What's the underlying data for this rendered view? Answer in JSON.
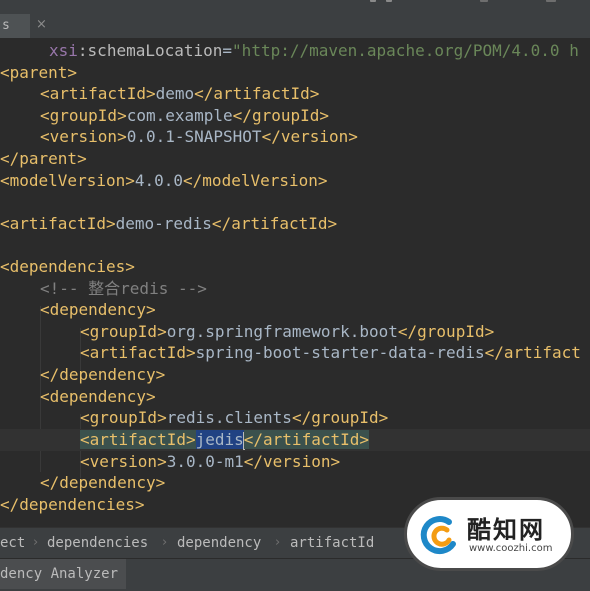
{
  "tab": {
    "label": "s",
    "close_glyph": "×"
  },
  "code": {
    "l1": {
      "attr_prefix": "xsi",
      "attr_name": "schemaLocation",
      "eq": "=",
      "value": "\"http://maven.apache.org/POM/4.0.0 h"
    },
    "l2": {
      "text": "<parent>"
    },
    "l3": {
      "open": "<artifactId>",
      "value": "demo",
      "close": "</artifactId>"
    },
    "l4": {
      "open": "<groupId>",
      "value": "com.example",
      "close": "</groupId>"
    },
    "l5": {
      "open": "<version>",
      "value": "0.0.1-SNAPSHOT",
      "close": "</version>"
    },
    "l6": {
      "text": "</parent>"
    },
    "l7": {
      "open": "<modelVersion>",
      "value": "4.0.0",
      "close": "</modelVersion>"
    },
    "l8": {
      "open": "<artifactId>",
      "value": "demo-redis",
      "close": "</artifactId>"
    },
    "l9": {
      "text": "<dependencies>"
    },
    "l10": {
      "text": "<!-- 整合redis -->"
    },
    "l11": {
      "text": "<dependency>"
    },
    "l12": {
      "open": "<groupId>",
      "value": "org.springframework.boot",
      "close": "</groupId>"
    },
    "l13": {
      "open": "<artifactId>",
      "value": "spring-boot-starter-data-redis",
      "close": "</artifact"
    },
    "l14": {
      "text": "</dependency>"
    },
    "l15": {
      "text": "<dependency>"
    },
    "l16": {
      "open": "<groupId>",
      "value": "redis.clients",
      "close": "</groupId>"
    },
    "l17": {
      "open": "<artifactId>",
      "value": "jedis",
      "close": "</artifactId>"
    },
    "l18": {
      "open": "<version>",
      "value": "3.0.0-m1",
      "close": "</version>"
    },
    "l19": {
      "text": "</dependency>"
    },
    "l20": {
      "text": "</dependencies>"
    }
  },
  "breadcrumb": {
    "items": [
      "ect",
      "dependencies",
      "dependency",
      "artifactId"
    ],
    "separator_icon": "chevron-right-icon"
  },
  "tool_window": {
    "label": "dency Analyzer"
  },
  "watermark": {
    "brand": "酷知网",
    "url": "www.coozhi.com"
  },
  "colors": {
    "background": "#2b2b2b",
    "tag": "#e8bf6a",
    "text": "#a9b7c6",
    "attribute_value": "#6a8759",
    "comment": "#808080",
    "namespace": "#9876aa",
    "tag_match_highlight": "#3b514d"
  }
}
